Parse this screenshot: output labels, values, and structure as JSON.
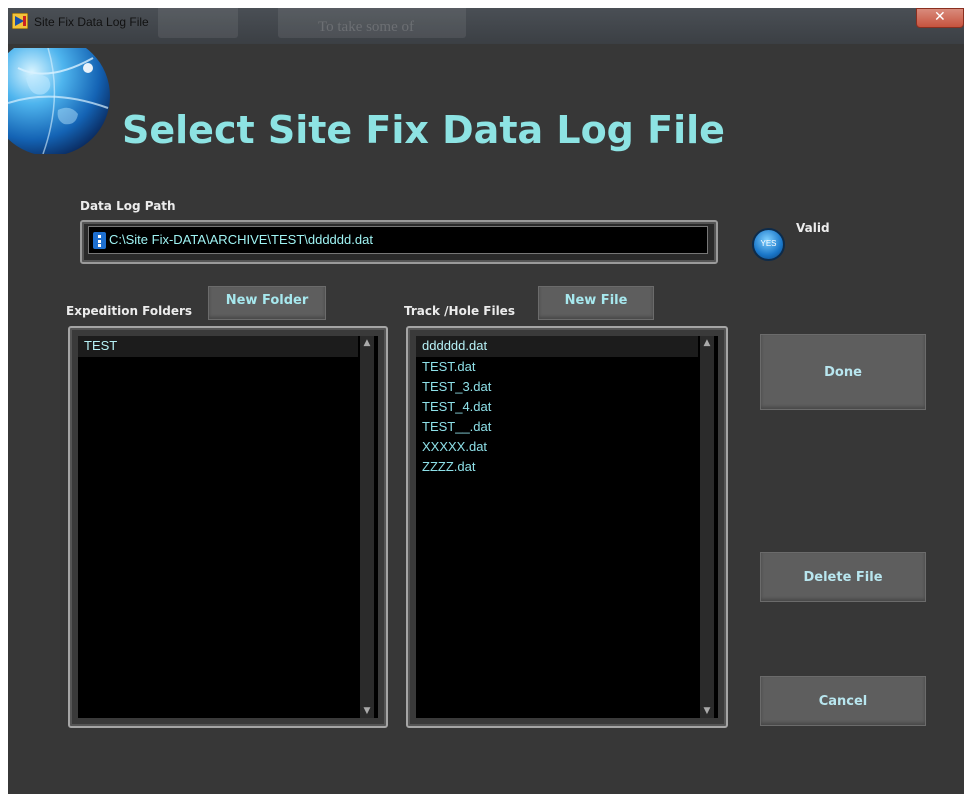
{
  "window": {
    "title": "Site Fix Data Log File",
    "background_hint": "To take some of"
  },
  "heading": "Select Site Fix Data Log File",
  "data_log_path": {
    "label": "Data Log Path",
    "value": "C:\\Site Fix-DATA\\ARCHIVE\\TEST\\dddddd.dat"
  },
  "validity": {
    "led_text": "YES",
    "label": "Valid"
  },
  "expedition_folders": {
    "label": "Expedition Folders",
    "new_button": "New Folder",
    "items": [
      "TEST"
    ],
    "selected_index": 0
  },
  "track_hole_files": {
    "label": "Track /Hole Files",
    "new_button": "New File",
    "items": [
      "dddddd.dat",
      "TEST.dat",
      "TEST_3.dat",
      "TEST_4.dat",
      "TEST__.dat",
      "XXXXX.dat",
      "ZZZZ.dat"
    ],
    "selected_index": 0
  },
  "actions": {
    "done": "Done",
    "delete_file": "Delete File",
    "cancel": "Cancel"
  },
  "colors": {
    "heading": "#8de3e3",
    "list_text": "#8ee0e8",
    "panel_bg": "#373737",
    "led": "#1a77c9"
  },
  "icons": {
    "app": "labview-vi-icon",
    "globe": "globe-icon",
    "path": "path-browse-icon"
  }
}
